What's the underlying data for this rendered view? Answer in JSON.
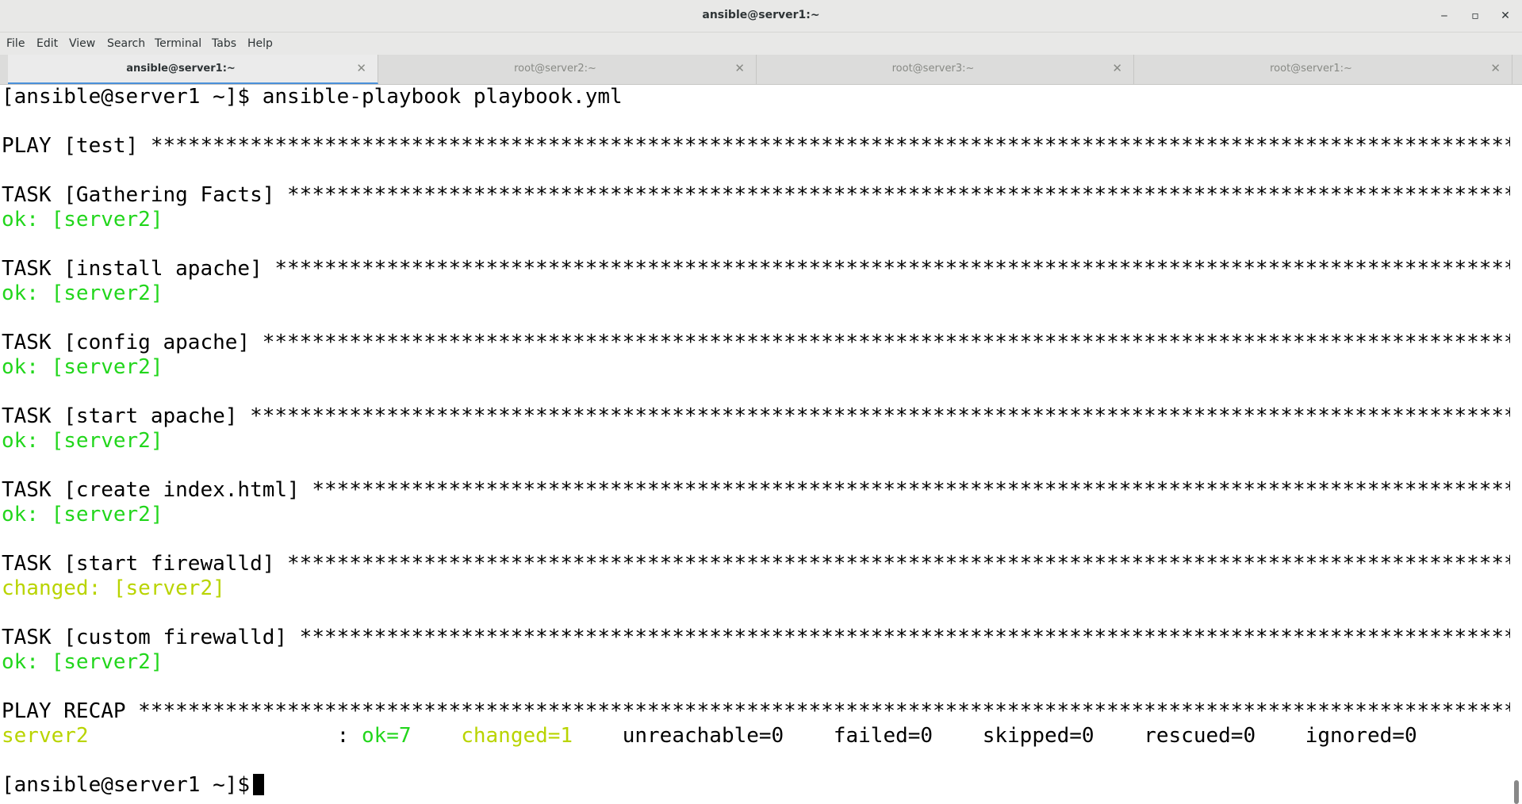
{
  "window": {
    "title": "ansible@server1:~",
    "minimize": "‒",
    "maximize": "▫",
    "close": "✕"
  },
  "menu": [
    "File",
    "Edit",
    "View",
    "Search",
    "Terminal",
    "Tabs",
    "Help"
  ],
  "tabs": [
    {
      "label": "ansible@server1:~",
      "close": "✕",
      "active": true
    },
    {
      "label": "root@server2:~",
      "close": "✕",
      "active": false
    },
    {
      "label": "root@server3:~",
      "close": "✕",
      "active": false
    },
    {
      "label": "root@server1:~",
      "close": "✕",
      "active": false
    }
  ],
  "terminal": {
    "prompt": "[ansible@server1 ~]$ ansible-playbook playbook.yml",
    "play": "PLAY [test] ***************************************************************************************************************************************",
    "tasks": [
      {
        "header": "TASK [Gathering Facts] ************************************************************************************************************************",
        "result": "ok: [server2]"
      },
      {
        "header": "TASK [install apache] *************************************************************************************************************************",
        "result": "ok: [server2]"
      },
      {
        "header": "TASK [config apache] **************************************************************************************************************************",
        "result": "ok: [server2]"
      },
      {
        "header": "TASK [start apache] ***************************************************************************************************************************",
        "result": "ok: [server2]"
      },
      {
        "header": "TASK [create index.html] **********************************************************************************************************************",
        "result": "ok: [server2]"
      },
      {
        "header": "TASK [start firewalld] ************************************************************************************************************************",
        "result": "changed: [server2]"
      },
      {
        "header": "TASK [custom firewalld] ***********************************************************************************************************************",
        "result": "ok: [server2]"
      }
    ],
    "recap_header": "PLAY RECAP ********************************************************************************************************************************",
    "recap": {
      "host": "server2",
      "sep": "                    : ",
      "ok": "ok=7",
      "changed": "changed=1",
      "unreachable": "unreachable=0",
      "failed": "failed=0",
      "skipped": "skipped=0",
      "rescued": "rescued=0",
      "ignored": "ignored=0"
    },
    "final_prompt": "[ansible@server1 ~]$"
  },
  "colors": {
    "ok": "#22d61c",
    "changed": "#b9d400",
    "tab_accent": "#4a90d9"
  }
}
